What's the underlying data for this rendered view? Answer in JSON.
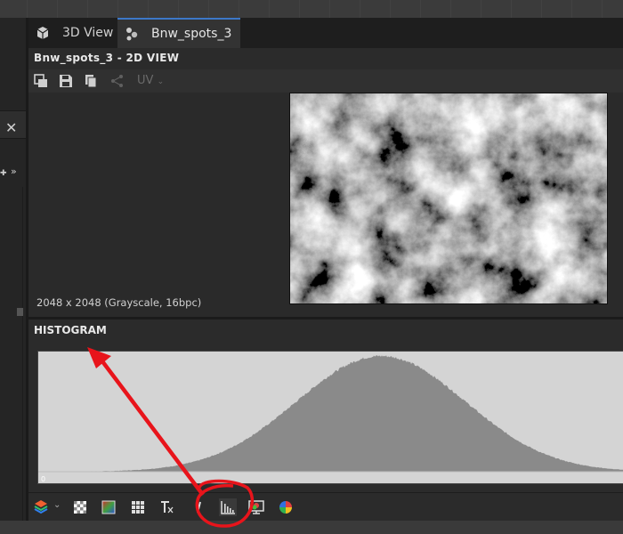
{
  "tabs": [
    {
      "label": "3D View",
      "icon": "cube-icon"
    },
    {
      "label": "Bnw_spots_3",
      "icon": "graph-node-icon",
      "active": true
    }
  ],
  "view": {
    "title": "Bnw_spots_3 - 2D VIEW",
    "toolbar": {
      "icons": [
        "fit-view-icon",
        "save-icon",
        "copy-icon",
        "share-icon"
      ],
      "uv_label": "UV"
    },
    "resolution_info": "2048 x 2048 (Grayscale, 16bpc)"
  },
  "histogram": {
    "title": "HISTOGRAM",
    "axis_start": "0"
  },
  "bottom_toolbar": {
    "icons": [
      "layers-icon",
      "checker-icon",
      "color-gradient-icon",
      "grid-icon",
      "tile-icon",
      "info-icon",
      "histogram-icon",
      "display-icon",
      "color-wheel-icon"
    ]
  },
  "colors": {
    "accent": "#3c78c8",
    "annotation": "#e8141b",
    "histogram_bg": "#d4d4d4",
    "histogram_fill": "#8a8a8a"
  }
}
